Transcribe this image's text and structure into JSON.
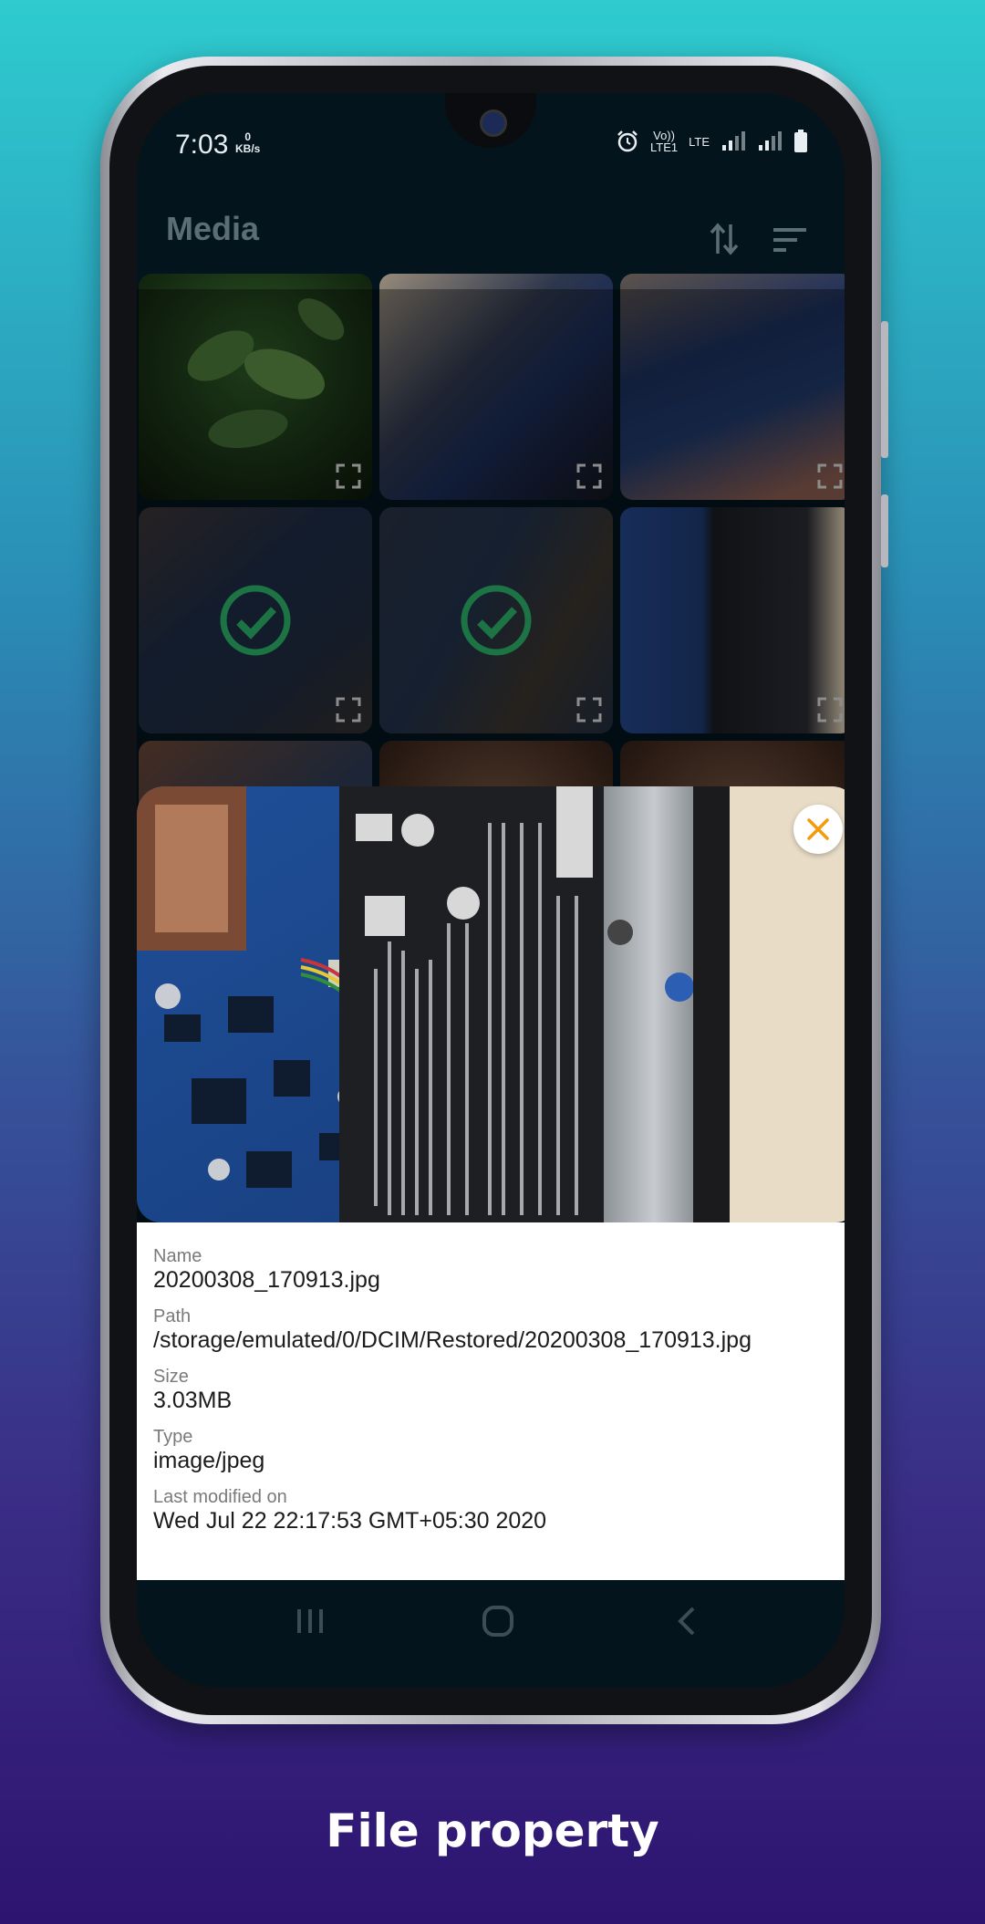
{
  "status_bar": {
    "time": "7:03",
    "net_speed_value": "0",
    "net_speed_unit": "KB/s",
    "volte_label": "Vo))",
    "lte_label": "LTE",
    "lte1_label": "LTE1"
  },
  "app_bar": {
    "title": "Media",
    "sort_icon": "swap-vert-icon",
    "filter_icon": "sort-lines-icon"
  },
  "grid": {
    "tiles": [
      {
        "subject": "leaves",
        "selected": false
      },
      {
        "subject": "laptop-internals",
        "selected": false
      },
      {
        "subject": "laptop-internals",
        "selected": false
      },
      {
        "subject": "circuit-board",
        "selected": true
      },
      {
        "subject": "circuit-board",
        "selected": true
      },
      {
        "subject": "battery",
        "selected": false
      },
      {
        "subject": "circuit-board",
        "selected": false
      },
      {
        "subject": "face",
        "selected": false
      },
      {
        "subject": "face",
        "selected": false
      }
    ]
  },
  "details": {
    "name_label": "Name",
    "name_value": "20200308_170913.jpg",
    "path_label": "Path",
    "path_value": "/storage/emulated/0/DCIM/Restored/20200308_170913.jpg",
    "size_label": "Size",
    "size_value": "3.03MB",
    "type_label": "Type",
    "type_value": "image/jpeg",
    "modified_label": "Last modified on",
    "modified_value": "Wed Jul 22 22:17:53 GMT+05:30 2020"
  },
  "nav_bar": {
    "recents_icon": "recents-icon",
    "home_icon": "home-icon",
    "back_icon": "back-icon"
  },
  "caption": "File property",
  "colors": {
    "accent": "#f59a0b",
    "check": "#2bb36a",
    "screen_bg": "#03141c"
  }
}
